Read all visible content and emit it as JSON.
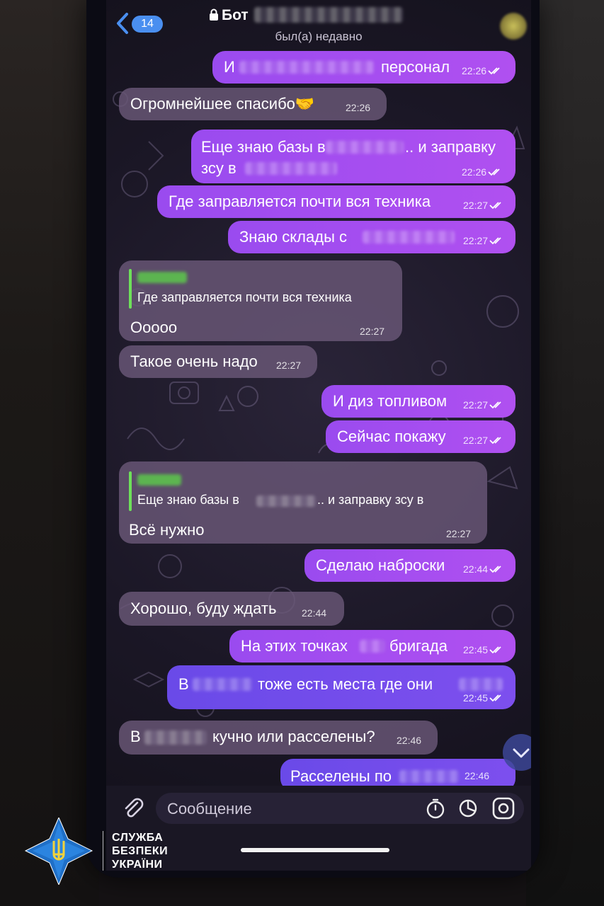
{
  "header": {
    "back_count": "14",
    "title": "Бот",
    "status": "был(а) недавно"
  },
  "messages": [
    {
      "text": "И",
      "text_after": "персонал",
      "time": "22:26"
    },
    {
      "text": "Огромнейшее спасибо🤝",
      "time": "22:26"
    },
    {
      "line1": "Еще знаю базы в",
      "line1_after": ".. и заправку",
      "line2": "зсу в",
      "time": "22:26"
    },
    {
      "text": "Где заправляется почти вся техника",
      "time": "22:27"
    },
    {
      "text": "Знаю склады с",
      "time": "22:27"
    },
    {
      "reply_text": "Где заправляется почти вся техника",
      "text": "Ооооо",
      "time": "22:27"
    },
    {
      "text": "Такое очень надо",
      "time": "22:27"
    },
    {
      "text": "И диз топливом",
      "time": "22:27"
    },
    {
      "text": "Сейчас покажу",
      "time": "22:27"
    },
    {
      "reply_text": "Еще знаю базы в",
      "reply_text_after": ".. и заправку зсу в",
      "text": "Всё нужно",
      "time": "22:27"
    },
    {
      "text": "Сделаю наброски",
      "time": "22:44"
    },
    {
      "text": "Хорошо, буду ждать",
      "time": "22:44"
    },
    {
      "text": "На этих точках",
      "text_after": "бригада",
      "time": "22:45"
    },
    {
      "text": "В",
      "text_after": "тоже есть места где они",
      "time": "22:45"
    },
    {
      "text": "В",
      "text_after": "кучно или расселены?",
      "time": "22:46"
    },
    {
      "text": "Расселены по",
      "time": "22:46"
    }
  ],
  "composer": {
    "placeholder": "Сообщение"
  },
  "watermark": {
    "line1": "СЛУЖБА",
    "line2": "БЕЗПЕКИ",
    "line3": "УКРАЇНИ"
  },
  "colors": {
    "outgoing": "#a64ef0",
    "outgoing_blue": "#7150ec",
    "incoming": "#6a5878",
    "reply_bar": "#6ee05a",
    "badge": "#4a8ff0"
  },
  "icons": [
    "chevron-left-icon",
    "lock-icon",
    "double-check-icon",
    "scroll-down-icon",
    "paperclip-icon",
    "timer-icon",
    "sticker-icon",
    "camera-icon",
    "sbu-trident-logo"
  ]
}
